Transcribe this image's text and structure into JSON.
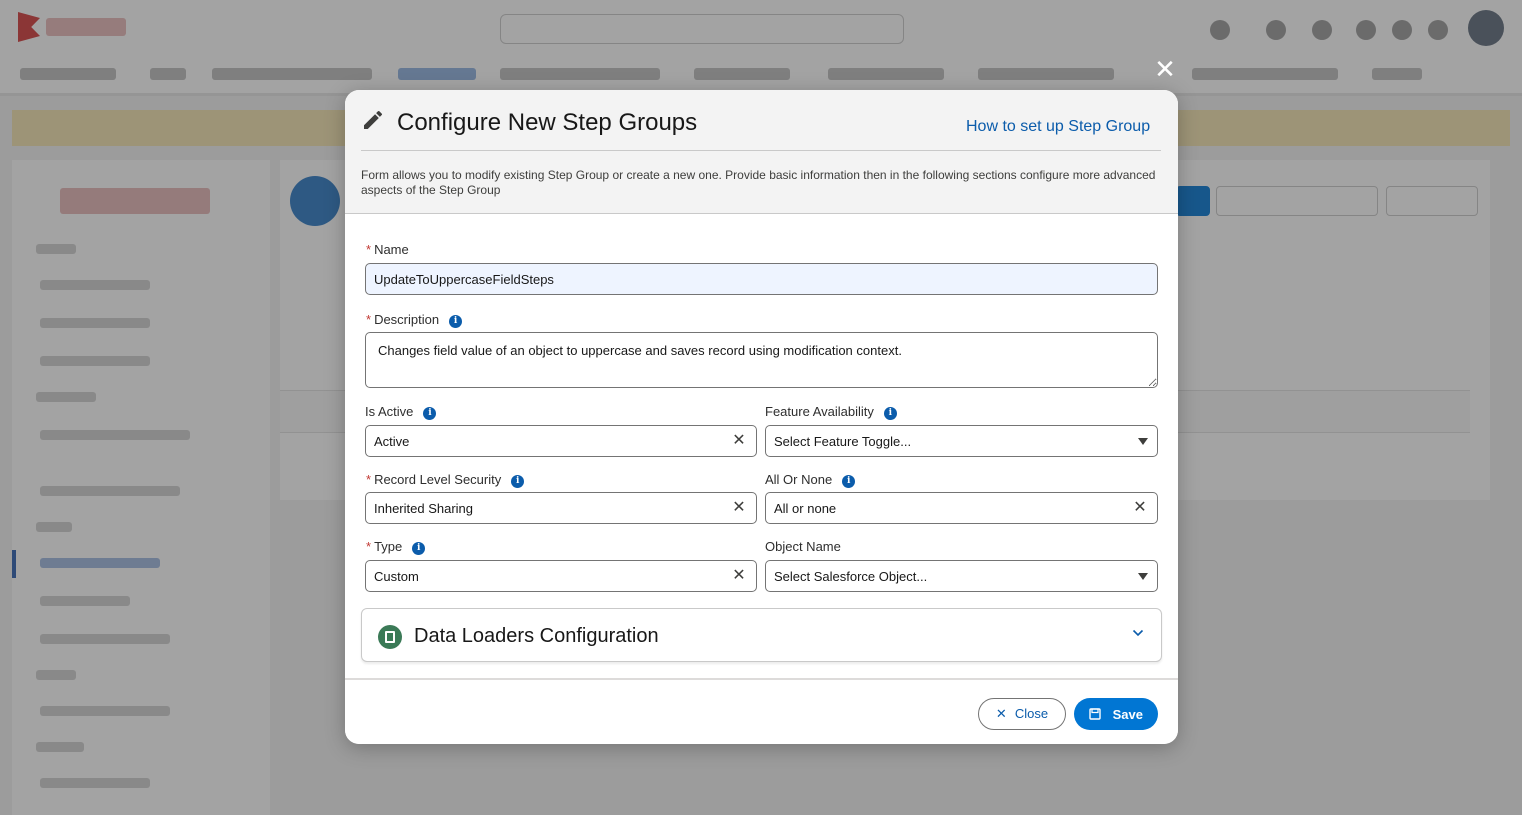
{
  "modal": {
    "title": "Configure New Step Groups",
    "help_link": "How to set up Step Group",
    "intro": "Form allows you to modify existing Step Group or create a new one. Provide basic information then in the following sections configure more advanced aspects of the Step Group"
  },
  "fields": {
    "name": {
      "label": "Name",
      "value": "UpdateToUppercaseFieldSteps"
    },
    "description": {
      "label": "Description",
      "value": "Changes field value of an object to uppercase and saves record using modification context."
    },
    "is_active": {
      "label": "Is Active",
      "value": "Active"
    },
    "feature_availability": {
      "label": "Feature Availability",
      "placeholder": "Select Feature Toggle..."
    },
    "record_level_security": {
      "label": "Record Level Security",
      "value": "Inherited Sharing"
    },
    "all_or_none": {
      "label": "All Or None",
      "value": "All or none"
    },
    "type": {
      "label": "Type",
      "value": "Custom"
    },
    "object_name": {
      "label": "Object Name",
      "placeholder": "Select Salesforce Object..."
    }
  },
  "accordion": {
    "title": "Data Loaders Configuration"
  },
  "footer": {
    "close_label": "Close",
    "save_label": "Save"
  },
  "icons": {
    "close": "close-icon",
    "edit": "pencil-icon",
    "info": "info-icon",
    "data_loader": "data-loader-icon",
    "chevron": "chevron-down-icon",
    "save": "save-icon"
  },
  "colors": {
    "brand": "#0176d3",
    "link": "#0b5cab",
    "required": "#c23934"
  }
}
